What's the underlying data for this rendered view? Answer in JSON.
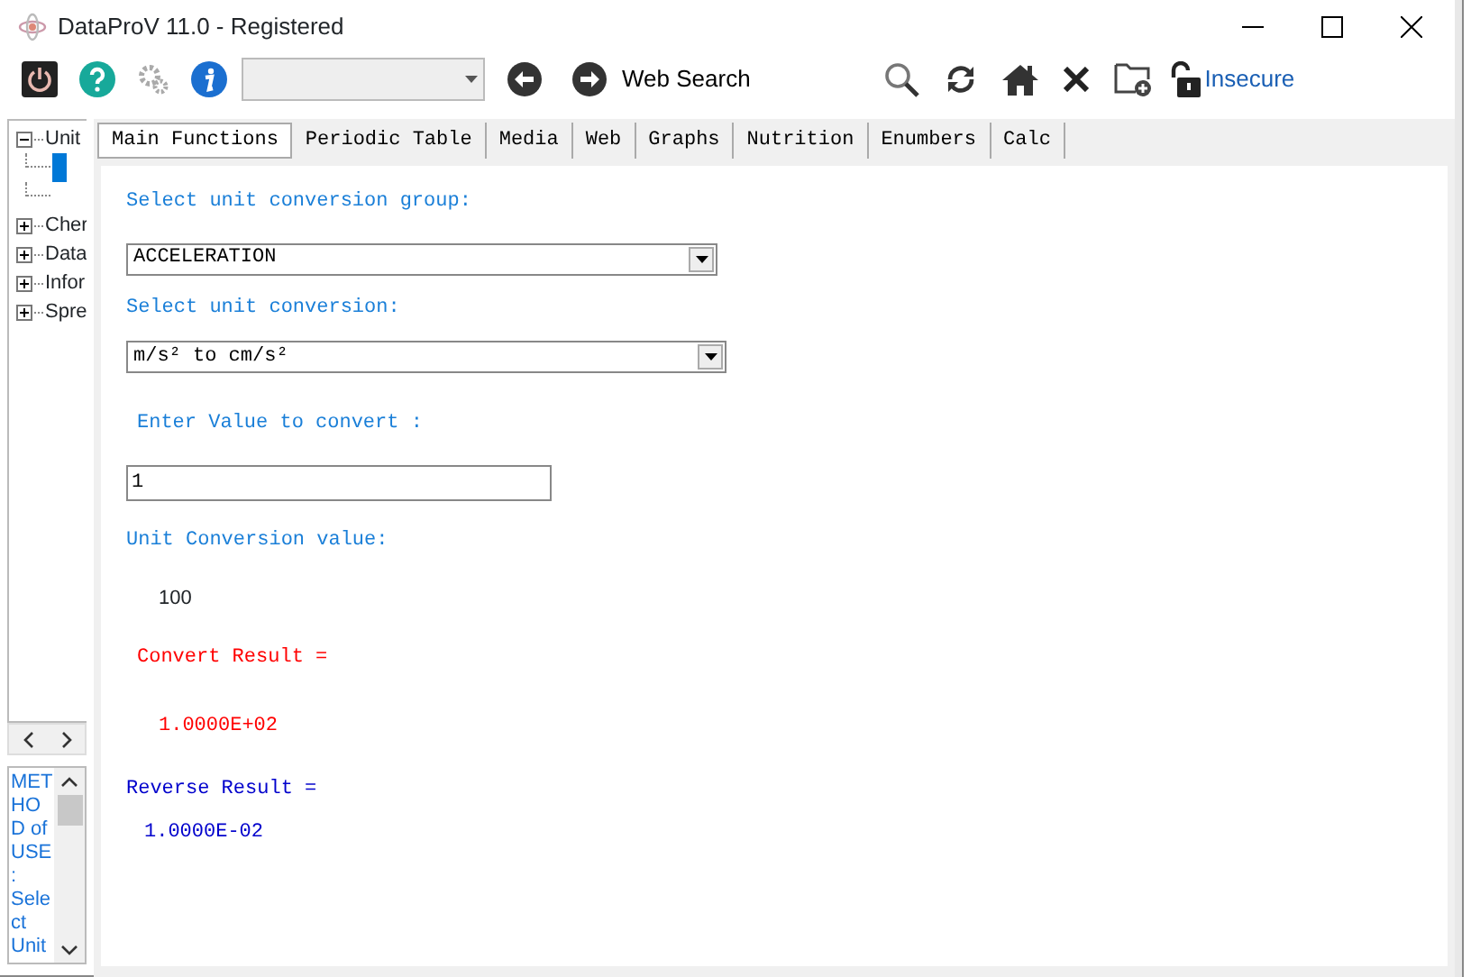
{
  "window": {
    "title": "DataProV 11.0 - Registered"
  },
  "toolbar": {
    "web_search": "Web Search",
    "security": "Insecure"
  },
  "tree": [
    {
      "label": "Unit",
      "expanded": true,
      "children": [
        {
          "selected": true
        },
        {
          "selected": false
        }
      ]
    },
    {
      "label": "Cher",
      "expanded": false
    },
    {
      "label": "Data",
      "expanded": false
    },
    {
      "label": "Infor",
      "expanded": false
    },
    {
      "label": "Spre",
      "expanded": false
    }
  ],
  "help_text": "METHOD of USE : Select Unit",
  "tabs": [
    {
      "label": "Main Functions",
      "selected": true
    },
    {
      "label": "Periodic Table",
      "selected": false
    },
    {
      "label": "Media",
      "selected": false
    },
    {
      "label": "Web",
      "selected": false
    },
    {
      "label": "Graphs",
      "selected": false
    },
    {
      "label": "Nutrition",
      "selected": false
    },
    {
      "label": "Enumbers",
      "selected": false
    },
    {
      "label": "Calc",
      "selected": false
    }
  ],
  "form": {
    "group_label": "Select unit conversion group:",
    "group_value": "ACCELERATION",
    "conversion_label": "Select unit conversion:",
    "conversion_value": "m/s² to cm/s²",
    "value_label": "Enter Value to convert :",
    "value": "1",
    "factor_label": "Unit Conversion value:",
    "factor": "100",
    "result_label": "Convert Result =",
    "result": "1.0000E+02",
    "reverse_label": "Reverse Result =",
    "reverse": "1.0000E-02"
  }
}
